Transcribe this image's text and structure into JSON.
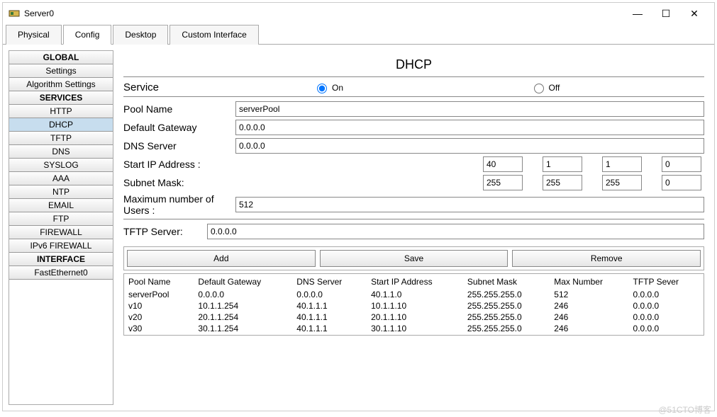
{
  "window": {
    "title": "Server0"
  },
  "tabs": [
    "Physical",
    "Config",
    "Desktop",
    "Custom Interface"
  ],
  "active_tab": "Config",
  "sidebar": {
    "groups": [
      {
        "cat": "GLOBAL",
        "items": [
          "Settings",
          "Algorithm Settings"
        ]
      },
      {
        "cat": "SERVICES",
        "items": [
          "HTTP",
          "DHCP",
          "TFTP",
          "DNS",
          "SYSLOG",
          "AAA",
          "NTP",
          "EMAIL",
          "FTP",
          "FIREWALL",
          "IPv6 FIREWALL"
        ]
      },
      {
        "cat": "INTERFACE",
        "items": [
          "FastEthernet0"
        ]
      }
    ],
    "active": "DHCP"
  },
  "panel": {
    "title": "DHCP",
    "service_label": "Service",
    "on_label": "On",
    "off_label": "Off",
    "service_on": true,
    "pool_name_label": "Pool Name",
    "pool_name": "serverPool",
    "default_gateway_label": "Default Gateway",
    "default_gateway": "0.0.0.0",
    "dns_server_label": "DNS Server",
    "dns_server": "0.0.0.0",
    "start_ip_label": "Start IP Address :",
    "start_ip": [
      "40",
      "1",
      "1",
      "0"
    ],
    "subnet_label": "Subnet Mask:",
    "subnet": [
      "255",
      "255",
      "255",
      "0"
    ],
    "max_users_label": "Maximum number of Users :",
    "max_users": "512",
    "tftp_label": "TFTP Server:",
    "tftp": "0.0.0.0",
    "btn_add": "Add",
    "btn_save": "Save",
    "btn_remove": "Remove"
  },
  "table": {
    "headers": [
      "Pool Name",
      "Default Gateway",
      "DNS Server",
      "Start IP Address",
      "Subnet Mask",
      "Max Number",
      "TFTP Sever"
    ],
    "rows": [
      [
        "serverPool",
        "0.0.0.0",
        "0.0.0.0",
        "40.1.1.0",
        "255.255.255.0",
        "512",
        "0.0.0.0"
      ],
      [
        "v10",
        "10.1.1.254",
        "40.1.1.1",
        "10.1.1.10",
        "255.255.255.0",
        "246",
        "0.0.0.0"
      ],
      [
        "v20",
        "20.1.1.254",
        "40.1.1.1",
        "20.1.1.10",
        "255.255.255.0",
        "246",
        "0.0.0.0"
      ],
      [
        "v30",
        "30.1.1.254",
        "40.1.1.1",
        "30.1.1.10",
        "255.255.255.0",
        "246",
        "0.0.0.0"
      ]
    ]
  },
  "watermark": "@51CTO博客"
}
